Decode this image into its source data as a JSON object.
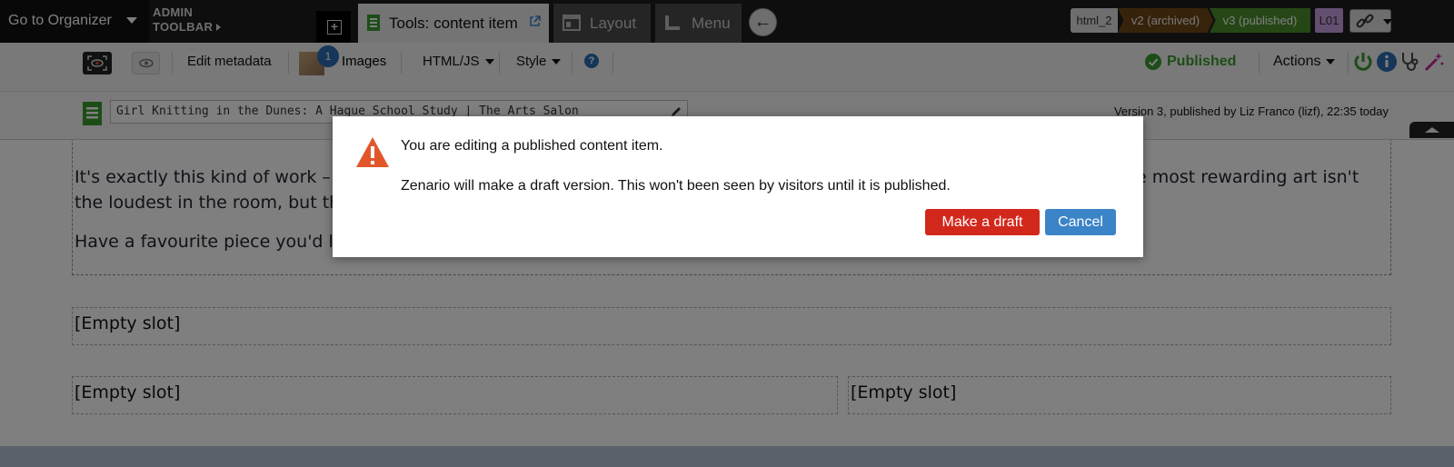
{
  "topbar": {
    "organizer_label": "Go to Organizer",
    "admin_toolbar_line1": "ADMIN",
    "admin_toolbar_line2": "TOOLBAR",
    "tabs": [
      {
        "label": "Tools: content item",
        "active": true
      },
      {
        "label": "Layout",
        "active": false
      },
      {
        "label": "Menu",
        "active": false
      }
    ],
    "versions": {
      "html": "html_2",
      "v2": "v2 (archived)",
      "v3": "v3 (published)",
      "layout_code": "L01"
    }
  },
  "toolbar2": {
    "edit_metadata": "Edit metadata",
    "images_label": "Images",
    "images_count": "1",
    "html_js": "HTML/JS",
    "style": "Style",
    "status": "Published",
    "actions": "Actions"
  },
  "titlebar": {
    "title_value": "Girl Knitting in the Dunes: A Hague School Study | The Arts Salon",
    "version_info": "Version 3, published by Liz Franco (lizf), 22:35 today"
  },
  "content": {
    "para1_start": "It's exactly this kind of work –",
    "para1_end": "e most rewarding art isn't",
    "para1_line2": "the loudest in the room, but th",
    "para2": "Have a favourite piece you'd lik",
    "empty_slot": "[Empty slot]"
  },
  "dialog": {
    "title": "You are editing a published content item.",
    "message": "Zenario will make a draft version. This won't been seen by visitors until it is published.",
    "make_draft": "Make a draft",
    "cancel": "Cancel"
  },
  "colors": {
    "published_green": "#3a9b2e",
    "draft_red": "#d2281c",
    "cancel_blue": "#3a84c7",
    "warning_orange": "#e2572a"
  }
}
